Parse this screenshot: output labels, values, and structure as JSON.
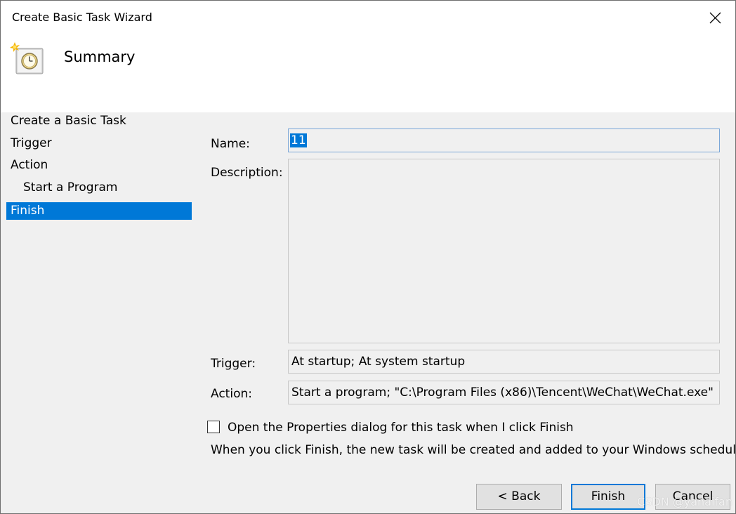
{
  "window": {
    "title": "Create Basic Task Wizard"
  },
  "header": {
    "title": "Summary",
    "icon": "task-scheduler-clock-icon"
  },
  "nav": {
    "items": [
      {
        "label": "Create a Basic Task",
        "selected": false
      },
      {
        "label": "Trigger",
        "selected": false
      },
      {
        "label": "Action",
        "selected": false
      },
      {
        "label": "Start a Program",
        "selected": false
      },
      {
        "label": "Finish",
        "selected": true
      }
    ]
  },
  "form": {
    "name_label": "Name:",
    "name_value": "11",
    "description_label": "Description:",
    "description_value": "",
    "trigger_label": "Trigger:",
    "trigger_value": "At startup; At system startup",
    "action_label": "Action:",
    "action_value": "Start a program; \"C:\\Program Files (x86)\\Tencent\\WeChat\\WeChat.exe\"",
    "open_properties_label": "Open the Properties dialog for this task when I click Finish",
    "open_properties_checked": false,
    "info_text": "When you click Finish, the new task will be created and added to your Windows schedule."
  },
  "buttons": {
    "back": "< Back",
    "finish": "Finish",
    "cancel": "Cancel"
  },
  "watermark": "CSDN @yanaifan",
  "colors": {
    "selection_blue": "#0078d7",
    "dialog_bg": "#f0f0f0",
    "header_bg": "#ffffff"
  }
}
